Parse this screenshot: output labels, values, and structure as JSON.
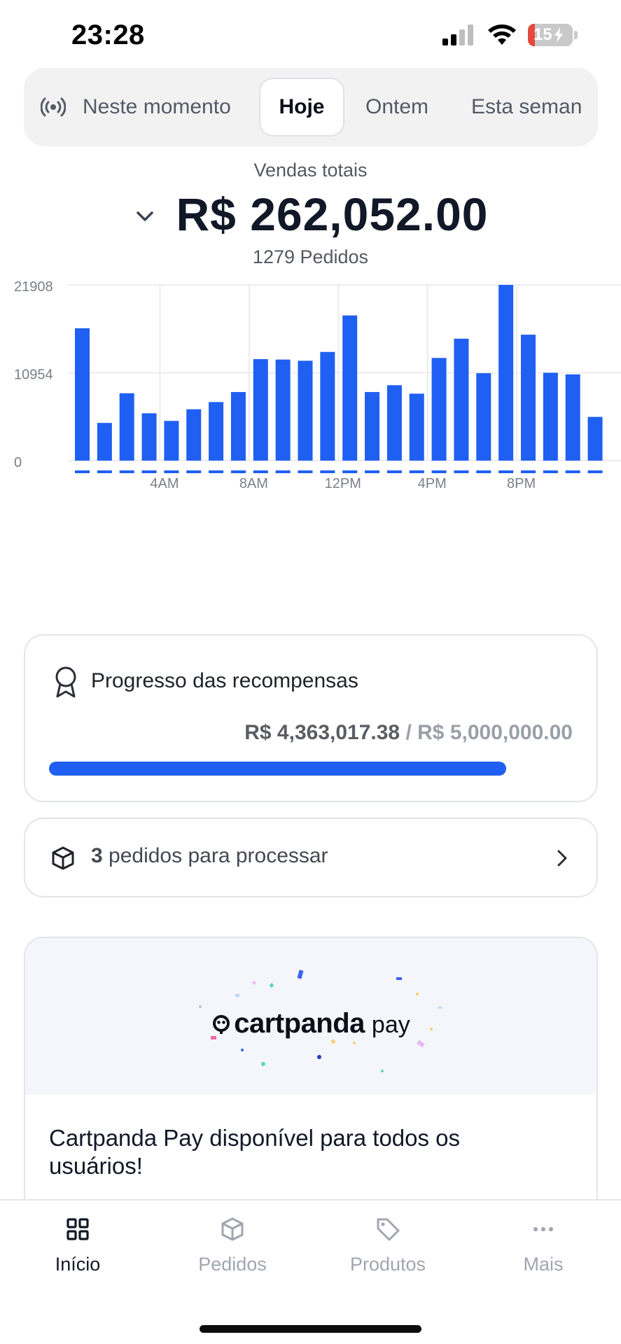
{
  "status_bar": {
    "time": "23:28",
    "battery": "15"
  },
  "tabs": [
    {
      "label": "Neste momento",
      "icon": "broadcast-icon"
    },
    {
      "label": "Hoje",
      "active": true
    },
    {
      "label": "Ontem"
    },
    {
      "label": "Esta seman"
    }
  ],
  "summary": {
    "label": "Vendas totais",
    "amount": "R$ 262,052.00",
    "orders": "1279 Pedidos"
  },
  "chart_data": {
    "type": "bar",
    "title": "",
    "xlabel": "",
    "ylabel": "",
    "y_ticks": [
      "21908",
      "10954",
      "0"
    ],
    "ylim": [
      0,
      21908
    ],
    "x_tick_labels": [
      "4AM",
      "8AM",
      "12PM",
      "4PM",
      "8PM"
    ],
    "categories": [
      "0",
      "1",
      "2",
      "3",
      "4",
      "5",
      "6",
      "7",
      "8",
      "9",
      "10",
      "11",
      "12",
      "13",
      "14",
      "15",
      "16",
      "17",
      "18",
      "19",
      "20",
      "21",
      "22",
      "23"
    ],
    "values": [
      16500,
      4700,
      8400,
      5900,
      4950,
      6400,
      7300,
      8550,
      12650,
      12600,
      12450,
      13550,
      18100,
      8550,
      9400,
      8350,
      12800,
      15200,
      10900,
      21908,
      15700,
      10950,
      10750,
      5450
    ],
    "color": "#1f5ff2",
    "grid": true,
    "legend": "none"
  },
  "rewards": {
    "title": "Progresso das recompensas",
    "current": "R$ 4,363,017.38",
    "separator": "/",
    "goal": "R$ 5,000,000.00",
    "progress": 0.8726
  },
  "orders_card": {
    "count": "3",
    "text": "pedidos para processar"
  },
  "promo": {
    "logo_word": "cartpanda",
    "logo_pay": "pay",
    "text": "Cartpanda Pay disponível para todos os usuários!"
  },
  "nav": [
    {
      "label": "Início",
      "icon": "grid-icon",
      "active": true
    },
    {
      "label": "Pedidos",
      "icon": "box-icon"
    },
    {
      "label": "Produtos",
      "icon": "tag-icon"
    },
    {
      "label": "Mais",
      "icon": "more-icon"
    }
  ],
  "colors": {
    "accent": "#1f5ff2",
    "text": "#111827",
    "muted": "#a0a6af"
  }
}
